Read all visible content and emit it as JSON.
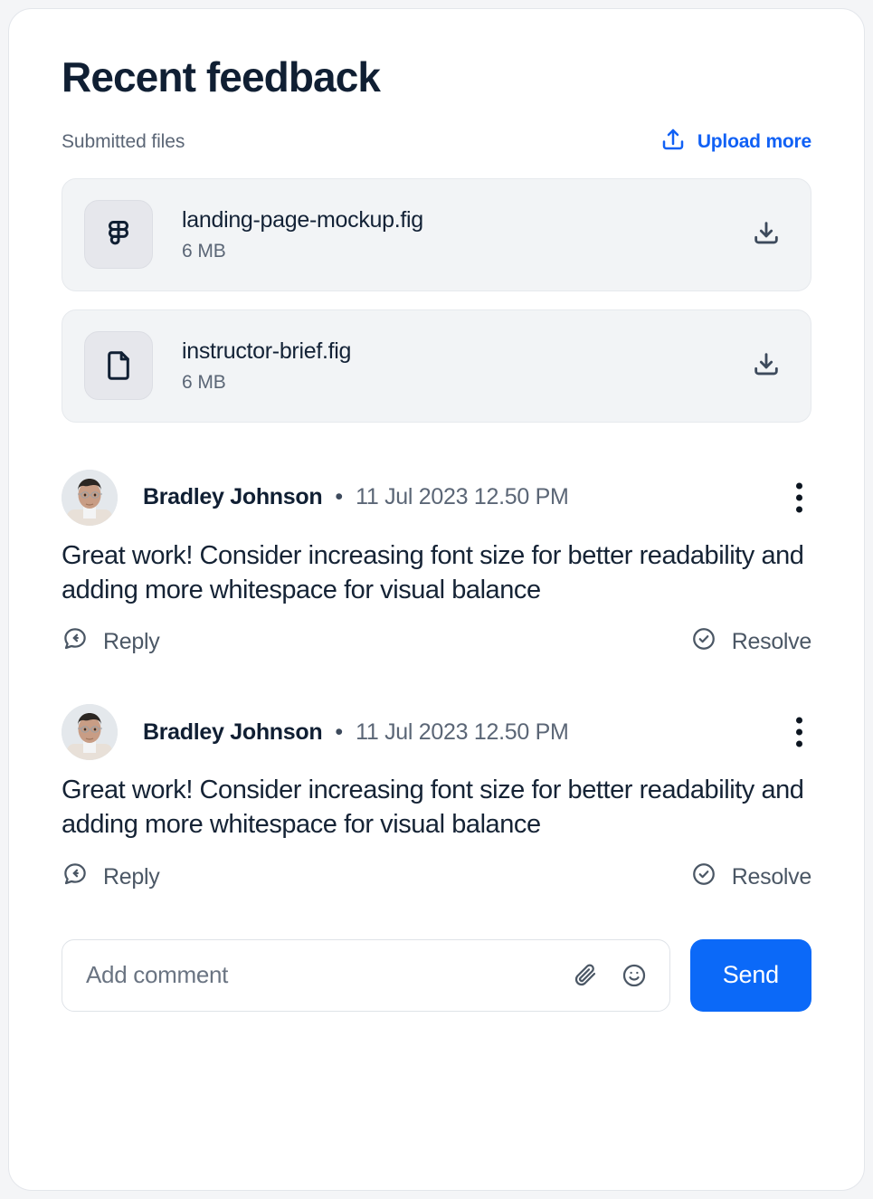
{
  "card": {
    "title": "Recent feedback",
    "submitted_files_label": "Submitted files",
    "upload_more_label": "Upload more",
    "accent_color": "#1161f5",
    "send_button_color": "#0b69f8"
  },
  "files": [
    {
      "name": "landing-page-mockup.fig",
      "size": "6 MB",
      "icon": "figma-icon",
      "action_icon": "download-icon"
    },
    {
      "name": "instructor-brief.fig",
      "size": "6 MB",
      "icon": "document-icon",
      "action_icon": "download-icon"
    }
  ],
  "comments": [
    {
      "author": "Bradley Johnson",
      "separator": "•",
      "timestamp": "11 Jul 2023 12.50 PM",
      "body": "Great work! Consider increasing font size for better readability and adding more whitespace for visual balance",
      "reply_label": "Reply",
      "resolve_label": "Resolve",
      "menu_icon": "kebab-menu-icon"
    },
    {
      "author": "Bradley Johnson",
      "separator": "•",
      "timestamp": "11 Jul 2023 12.50 PM",
      "body": "Great work! Consider increasing font size for better readability and adding more whitespace for visual balance",
      "reply_label": "Reply",
      "resolve_label": "Resolve",
      "menu_icon": "kebab-menu-icon"
    }
  ],
  "composer": {
    "placeholder": "Add comment",
    "value": "",
    "attach_icon": "paperclip-icon",
    "emoji_icon": "smiley-icon",
    "send_label": "Send"
  }
}
